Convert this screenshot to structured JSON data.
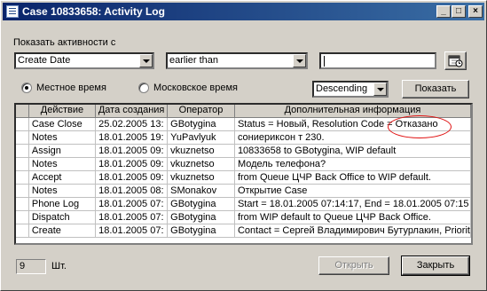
{
  "window": {
    "title": "Case 10833658: Activity Log",
    "min_symbol": "_",
    "max_symbol": "□",
    "close_symbol": "×"
  },
  "filter": {
    "section_label": "Показать активности с",
    "field_combo": "Create Date",
    "operator_combo": "earlier than",
    "date_value": ""
  },
  "timezone": {
    "local_label": "Местное время",
    "moscow_label": "Московское время",
    "selected": "local"
  },
  "sort_combo": "Descending",
  "show_button": "Показать",
  "table": {
    "columns": [
      "Действие",
      "Дата создания",
      "Оператор",
      "Дополнительная информация"
    ],
    "rows": [
      [
        "Case Close",
        "25.02.2005 13:",
        "GBotygina",
        "Status = Новый, Resolution Code = Отказано"
      ],
      [
        "Notes",
        "18.01.2005 19:",
        "YuPavlyuk",
        "сониериксон т 230."
      ],
      [
        "Assign",
        "18.01.2005 09:",
        "vkuznetso",
        "10833658 to  GBotygina, WIP default"
      ],
      [
        "Notes",
        "18.01.2005 09:",
        "vkuznetso",
        "Модель телефона?"
      ],
      [
        "Accept",
        "18.01.2005 09:",
        "vkuznetso",
        "from Queue ЦЧР Back Office to WIP default."
      ],
      [
        "Notes",
        "18.01.2005 08:",
        "SMonakov",
        "Открытие Case"
      ],
      [
        "Phone Log",
        "18.01.2005 07:",
        "GBotygina",
        "Start = 18.01.2005 07:14:17, End = 18.01.2005 07:15"
      ],
      [
        "Dispatch",
        "18.01.2005 07:",
        "GBotygina",
        "from WIP default to Queue ЦЧР Back Office."
      ],
      [
        "Create",
        "18.01.2005 07:",
        "GBotygina",
        "Contact = Сергей Владимирович Бутурлакин, Priorit"
      ]
    ]
  },
  "footer": {
    "count": "9",
    "count_unit": "Шт.",
    "open_button": "Открыть",
    "close_button": "Закрыть"
  },
  "colors": {
    "titlebar_start": "#0a246a",
    "titlebar_end": "#3a6ea5",
    "annotation": "#e01010"
  },
  "icons": [
    "app-list-icon",
    "calendar-icon",
    "dropdown-arrow-icon"
  ]
}
